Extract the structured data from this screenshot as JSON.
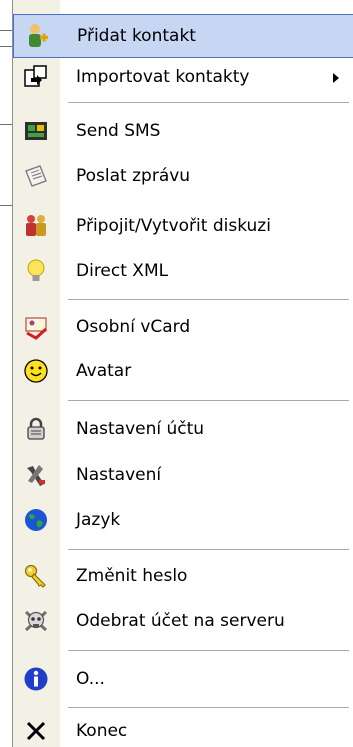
{
  "menu": {
    "items": [
      {
        "label": "Přidat kontakt",
        "icon": "add-contact-icon"
      },
      {
        "label": "Importovat kontakty",
        "icon": "import-contacts-icon"
      },
      {
        "label": "Send SMS",
        "icon": "sms-icon"
      },
      {
        "label": "Poslat zprávu",
        "icon": "message-icon"
      },
      {
        "label": "Připojit/Vytvořit diskuzi",
        "icon": "chat-room-icon"
      },
      {
        "label": "Direct XML",
        "icon": "lightbulb-icon"
      },
      {
        "label": "Osobní vCard",
        "icon": "vcard-icon"
      },
      {
        "label": "Avatar",
        "icon": "smiley-icon"
      },
      {
        "label": "Nastavení účtu",
        "icon": "lock-icon"
      },
      {
        "label": "Nastavení",
        "icon": "tools-icon"
      },
      {
        "label": "Jazyk",
        "icon": "globe-icon"
      },
      {
        "label": "Změnit heslo",
        "icon": "key-icon"
      },
      {
        "label": "Odebrat účet na serveru",
        "icon": "skull-icon"
      },
      {
        "label": "O...",
        "icon": "info-icon"
      },
      {
        "label": "Konec",
        "icon": "close-icon"
      }
    ]
  },
  "colors": {
    "highlight_fill": "#c7d6f3",
    "highlight_border": "#4c72c7",
    "separator": "#a9a9a9"
  }
}
